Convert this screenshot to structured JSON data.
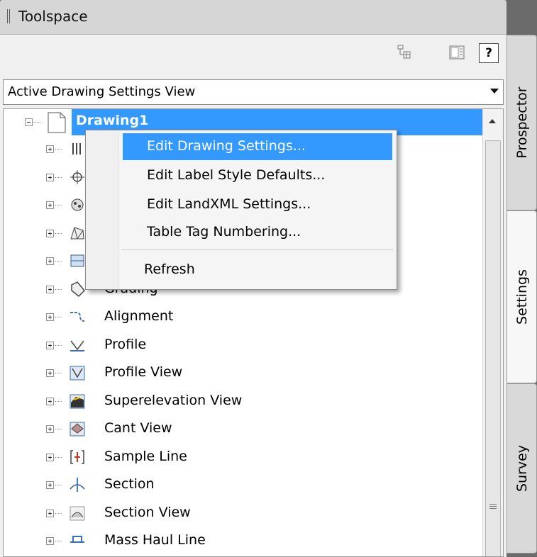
{
  "window": {
    "title": "Toolspace"
  },
  "toolbar": {
    "help_label": "?"
  },
  "view_select": {
    "selected": "Active Drawing Settings View"
  },
  "tree": {
    "root": {
      "label": "Drawing1"
    },
    "items": [
      {
        "label": "",
        "icon": "settings-icon"
      },
      {
        "label": "",
        "icon": "target-icon"
      },
      {
        "label": "",
        "icon": "survey-icon"
      },
      {
        "label": "",
        "icon": "surface-icon"
      },
      {
        "label": "",
        "icon": "parcel-icon"
      },
      {
        "label": "Grading",
        "icon": "grading-icon"
      },
      {
        "label": "Alignment",
        "icon": "alignment-icon"
      },
      {
        "label": "Profile",
        "icon": "profile-icon"
      },
      {
        "label": "Profile View",
        "icon": "profile-view-icon"
      },
      {
        "label": "Superelevation View",
        "icon": "superelevation-view-icon"
      },
      {
        "label": "Cant View",
        "icon": "cant-view-icon"
      },
      {
        "label": "Sample Line",
        "icon": "sample-line-icon"
      },
      {
        "label": "Section",
        "icon": "section-icon"
      },
      {
        "label": "Section View",
        "icon": "section-view-icon"
      },
      {
        "label": "Mass Haul Line",
        "icon": "mass-haul-line-icon"
      }
    ]
  },
  "context_menu": {
    "items": [
      {
        "label": "Edit Drawing Settings..."
      },
      {
        "label": "Edit Label Style Defaults..."
      },
      {
        "label": "Edit LandXML Settings..."
      },
      {
        "label": "Table Tag Numbering..."
      },
      {
        "label": "Refresh"
      }
    ]
  },
  "side_tabs": [
    {
      "label": "Prospector"
    },
    {
      "label": "Settings"
    },
    {
      "label": "Survey"
    }
  ],
  "colors": {
    "selection": "#3399ff",
    "panel": "#f0f0f0"
  }
}
